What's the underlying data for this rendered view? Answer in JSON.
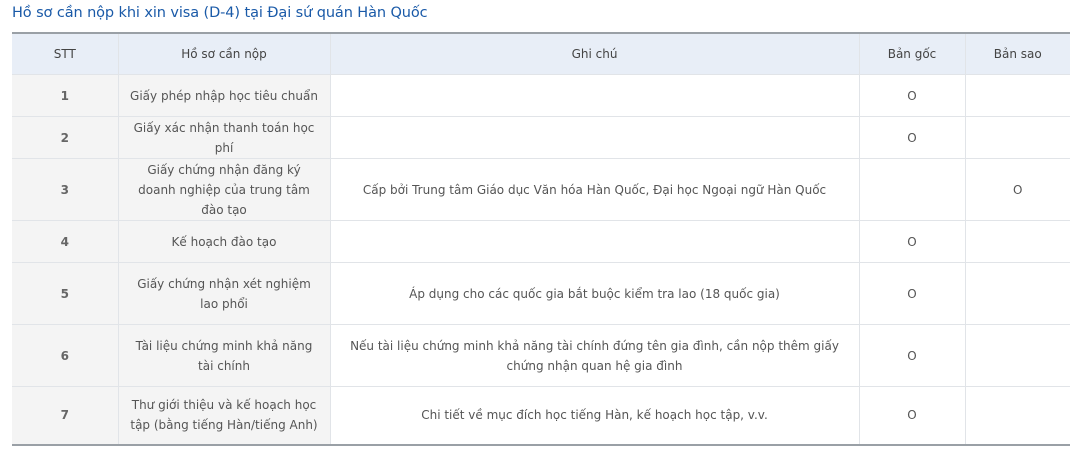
{
  "title": "Hồ sơ cần nộp khi xin visa (D-4) tại Đại sứ quán Hàn Quốc",
  "table": {
    "headers": [
      "STT",
      "Hồ sơ cần nộp",
      "Ghi chú",
      "Bản gốc",
      "Bản sao"
    ],
    "rows": [
      {
        "stt": "1",
        "doc": "Giấy phép nhập học tiêu chuẩn",
        "note": "",
        "original": "O",
        "copy": ""
      },
      {
        "stt": "2",
        "doc": "Giấy xác nhận thanh toán học phí",
        "note": "",
        "original": "O",
        "copy": ""
      },
      {
        "stt": "3",
        "doc": "Giấy chứng nhận đăng ký doanh nghiệp của trung tâm đào tạo",
        "note": "Cấp bởi Trung tâm Giáo dục Văn hóa Hàn Quốc, Đại học Ngoại ngữ Hàn Quốc",
        "original": "",
        "copy": "O"
      },
      {
        "stt": "4",
        "doc": "Kế hoạch đào tạo",
        "note": "",
        "original": "O",
        "copy": ""
      },
      {
        "stt": "5",
        "doc": "Giấy chứng nhận xét nghiệm lao phổi",
        "note": "Áp dụng cho các quốc gia bắt buộc kiểm tra lao (18 quốc gia)",
        "original": "O",
        "copy": ""
      },
      {
        "stt": "6",
        "doc": "Tài liệu chứng minh khả năng tài chính",
        "note": "Nếu tài liệu chứng minh khả năng tài chính đứng tên gia đình, cần nộp thêm giấy chứng nhận quan hệ gia đình",
        "original": "O",
        "copy": ""
      },
      {
        "stt": "7",
        "doc": "Thư giới thiệu và kế hoạch học tập (bằng tiếng Hàn/tiếng Anh)",
        "note": "Chi tiết về mục đích học tiếng Hàn, kế hoạch học tập, v.v.",
        "original": "O",
        "copy": ""
      }
    ]
  }
}
